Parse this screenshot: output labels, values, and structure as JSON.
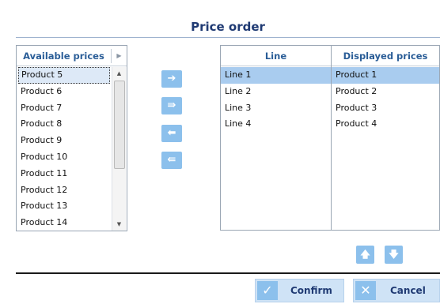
{
  "dialog": {
    "title": "Price order"
  },
  "available": {
    "header": "Available prices",
    "items": [
      "Product 5",
      "Product 6",
      "Product 7",
      "Product 8",
      "Product 9",
      "Product 10",
      "Product 11",
      "Product 12",
      "Product 13",
      "Product 14"
    ],
    "selected_index": 0
  },
  "transfer_buttons": [
    {
      "name": "move-right-button",
      "icon": "arrow-right-icon",
      "glyph": "➔"
    },
    {
      "name": "move-all-right-button",
      "icon": "double-arrow-right-icon",
      "glyph": "⇛"
    },
    {
      "name": "move-left-button",
      "icon": "arrow-left-icon",
      "glyph": "⬅"
    },
    {
      "name": "move-all-left-button",
      "icon": "double-arrow-left-icon",
      "glyph": "⇚"
    }
  ],
  "table": {
    "columns": [
      "Line",
      "Displayed prices"
    ],
    "rows": [
      {
        "line": "Line 1",
        "price": "Product 1"
      },
      {
        "line": "Line 2",
        "price": "Product 2"
      },
      {
        "line": "Line 3",
        "price": "Product 3"
      },
      {
        "line": "Line 4",
        "price": "Product 4"
      }
    ],
    "selected_index": 0
  },
  "order_buttons": {
    "up_icon": "arrow-up-icon",
    "down_icon": "arrow-down-icon"
  },
  "footer": {
    "confirm_label": "Confirm",
    "cancel_label": "Cancel"
  },
  "colors": {
    "accent": "#8cc0ec",
    "title": "#1f3a73",
    "header_text": "#2a5d97",
    "selection": "#a9ccef"
  }
}
